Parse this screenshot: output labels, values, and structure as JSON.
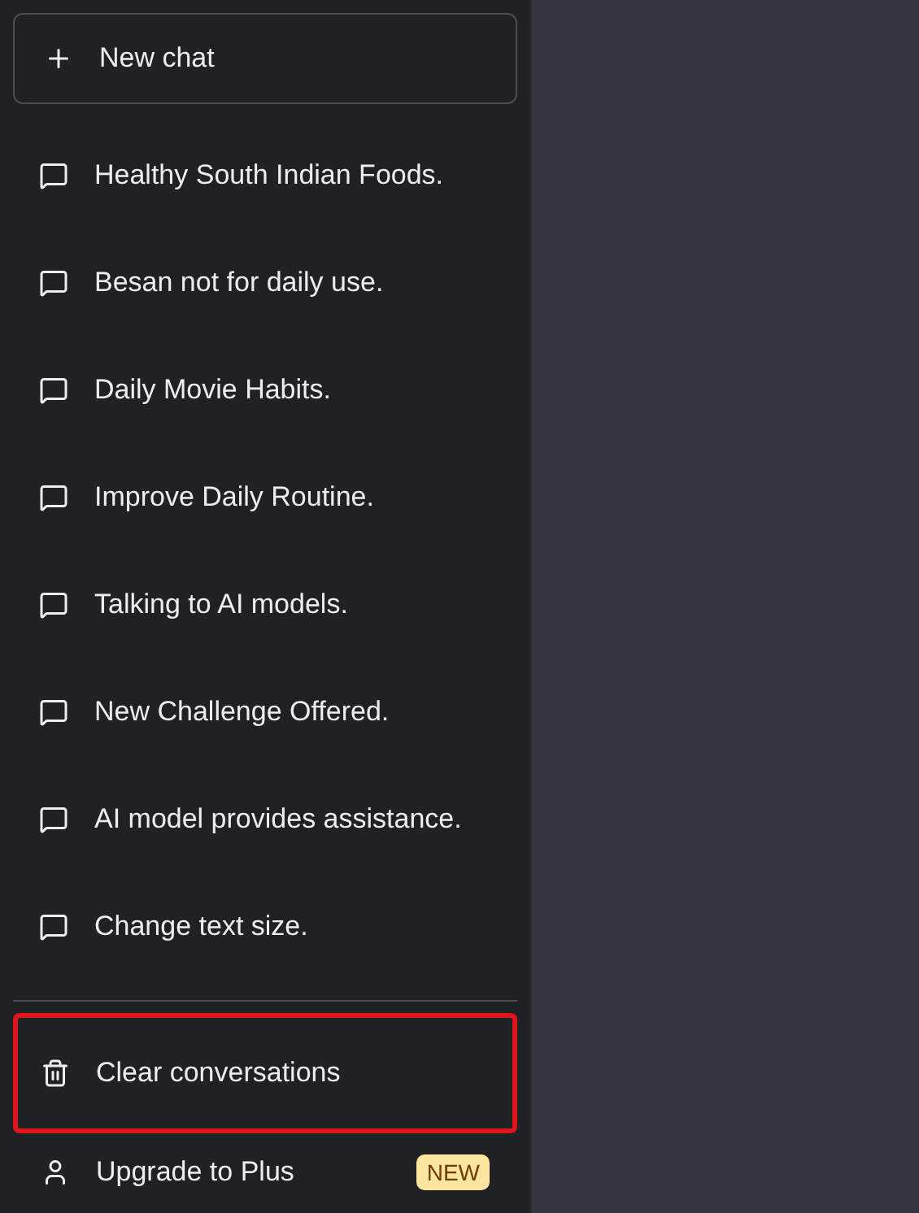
{
  "sidebar": {
    "new_chat": {
      "label": "New chat"
    },
    "conversations": [
      {
        "title": "Healthy South Indian Foods."
      },
      {
        "title": "Besan not for daily use."
      },
      {
        "title": "Daily Movie Habits."
      },
      {
        "title": "Improve Daily Routine."
      },
      {
        "title": "Talking to AI models."
      },
      {
        "title": "New Challenge Offered."
      },
      {
        "title": "AI model provides assistance."
      },
      {
        "title": "Change text size."
      }
    ],
    "bottom_items": [
      {
        "kind": "clear",
        "label": "Clear conversations",
        "highlighted": true
      },
      {
        "kind": "upgrade",
        "label": "Upgrade to Plus",
        "badge": "NEW",
        "highlighted": false
      }
    ]
  }
}
